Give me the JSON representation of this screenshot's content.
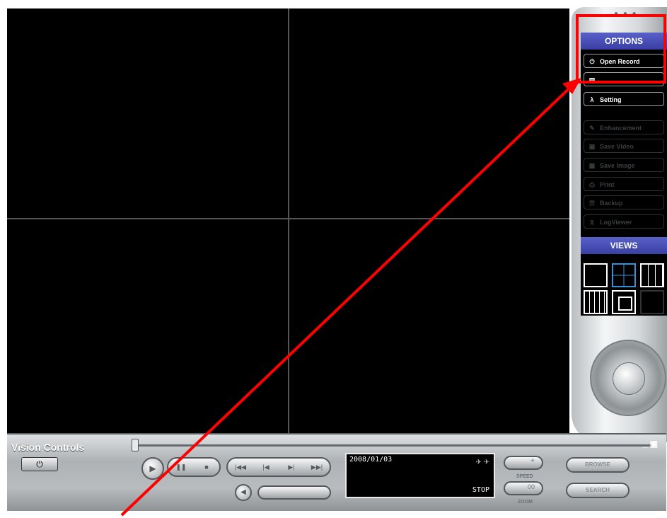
{
  "options": {
    "header": "OPTIONS",
    "items": [
      {
        "label": "Open Record",
        "icon": "power-icon",
        "enabled": true
      },
      {
        "label": "",
        "icon": "doc-icon",
        "enabled": true
      },
      {
        "label": "Setting",
        "icon": "lambda-icon",
        "enabled": true
      },
      {
        "label": "Enhancement",
        "icon": "pen-icon",
        "enabled": false
      },
      {
        "label": "Save Video",
        "icon": "video-icon",
        "enabled": false
      },
      {
        "label": "Save Image",
        "icon": "image-icon",
        "enabled": false
      },
      {
        "label": "Print",
        "icon": "printer-icon",
        "enabled": false
      },
      {
        "label": "Backup",
        "icon": "backup-icon",
        "enabled": false
      },
      {
        "label": "LogViewer",
        "icon": "log-icon",
        "enabled": false
      }
    ]
  },
  "views": {
    "header": "VIEWS"
  },
  "controls": {
    "title": "Vision Controls",
    "date": "2008/01/03",
    "status": "STOP",
    "speed_label": "SPEED",
    "zoom_label": "ZOOM",
    "browse_label": "BROWSE",
    "search_label": "SEARCH",
    "speed_plus": "+",
    "zoom_value": "00"
  },
  "colors": {
    "accent": "#4b50b8",
    "annotation": "#ff0000"
  }
}
